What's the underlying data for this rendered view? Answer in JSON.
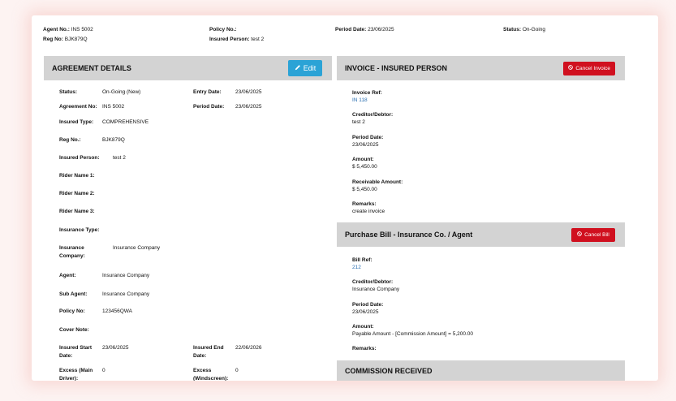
{
  "header": {
    "agent_no_label": "Agent No.:",
    "agent_no": "INS 5002",
    "reg_no_label": "Reg No:",
    "reg_no": "BJK879Q",
    "policy_no_label": "Policy No.:",
    "policy_no": "",
    "insured_person_label": "Insured Person:",
    "insured_person": "test 2",
    "period_date_label": "Period Date:",
    "period_date": "23/06/2025",
    "status_label": "Status:",
    "status": "On-Going"
  },
  "agreement": {
    "title": "AGREEMENT DETAILS",
    "edit_label": "Edit",
    "edit_icon": "pencil-icon",
    "fields": {
      "status_label": "Status:",
      "status": "On-Going (New)",
      "entry_date_label": "Entry Date:",
      "entry_date": "23/06/2025",
      "agreement_no_label": "Agreement No:",
      "agreement_no": "INS 5002",
      "period_date_label": "Period Date:",
      "period_date": "23/06/2025",
      "insured_type_label": "Insured Type:",
      "insured_type": "COMPREHENSIVE",
      "reg_no_label": "Reg No.:",
      "reg_no": "BJK879Q",
      "insured_person_label": "Insured Person:",
      "insured_person": "test 2",
      "rider1_label": "Rider Name 1:",
      "rider2_label": "Rider Name 2:",
      "rider3_label": "Rider Name 3:",
      "insurance_type_label": "Insurance Type:",
      "insurance_company_label": "Insurance Company:",
      "insurance_company": "Insurance Company",
      "agent_label": "Agent:",
      "agent": "Insurance Company",
      "sub_agent_label": "Sub Agent:",
      "sub_agent": "Insurance Company",
      "policy_no_label": "Policy No:",
      "policy_no": "123456QWA",
      "cover_note_label": "Cover Note:",
      "insured_start_label": "Insured Start Date:",
      "insured_start": "23/06/2025",
      "insured_end_label": "Insured End Date:",
      "insured_end": "22/06/2026",
      "excess_main_label": "Excess (Main Driver):",
      "excess_main": "0",
      "excess_wind_label": "Excess (Windscreen):",
      "excess_wind": "0"
    }
  },
  "invoice": {
    "title": "INVOICE - INSURED PERSON",
    "cancel_label": "Cancel Invoice",
    "cancel_icon": "ban-icon",
    "ref_label": "Invoice Ref:",
    "ref": "IN 118",
    "creditor_label": "Creditor/Debtor:",
    "creditor": "test 2",
    "period_label": "Period Date:",
    "period": "23/06/2025",
    "amount_label": "Amount:",
    "amount": "$ 5,450.00",
    "receivable_label": "Receivable Amount:",
    "receivable": "$ 5,450.00",
    "remarks_label": "Remarks:",
    "remarks": "create invoice"
  },
  "bill": {
    "title": "Purchase Bill - Insurance Co. / Agent",
    "cancel_label": "Cancel Bill",
    "cancel_icon": "ban-icon",
    "ref_label": "Bill Ref:",
    "ref": "212",
    "creditor_label": "Creditor/Debtor:",
    "creditor": "Insurance Company",
    "period_label": "Period Date:",
    "period": "23/06/2025",
    "amount_label": "Amount:",
    "amount": "Payable Amount - [Commission Amount] = 5,200.00",
    "remarks_label": "Remarks:",
    "remarks": ""
  },
  "commission": {
    "title": "COMMISSION RECEIVED"
  },
  "colors": {
    "edit_button": "#2ba3d6",
    "cancel_button": "#d0101f",
    "panel_header": "#d3d3d3",
    "link": "#2a6fb0"
  }
}
